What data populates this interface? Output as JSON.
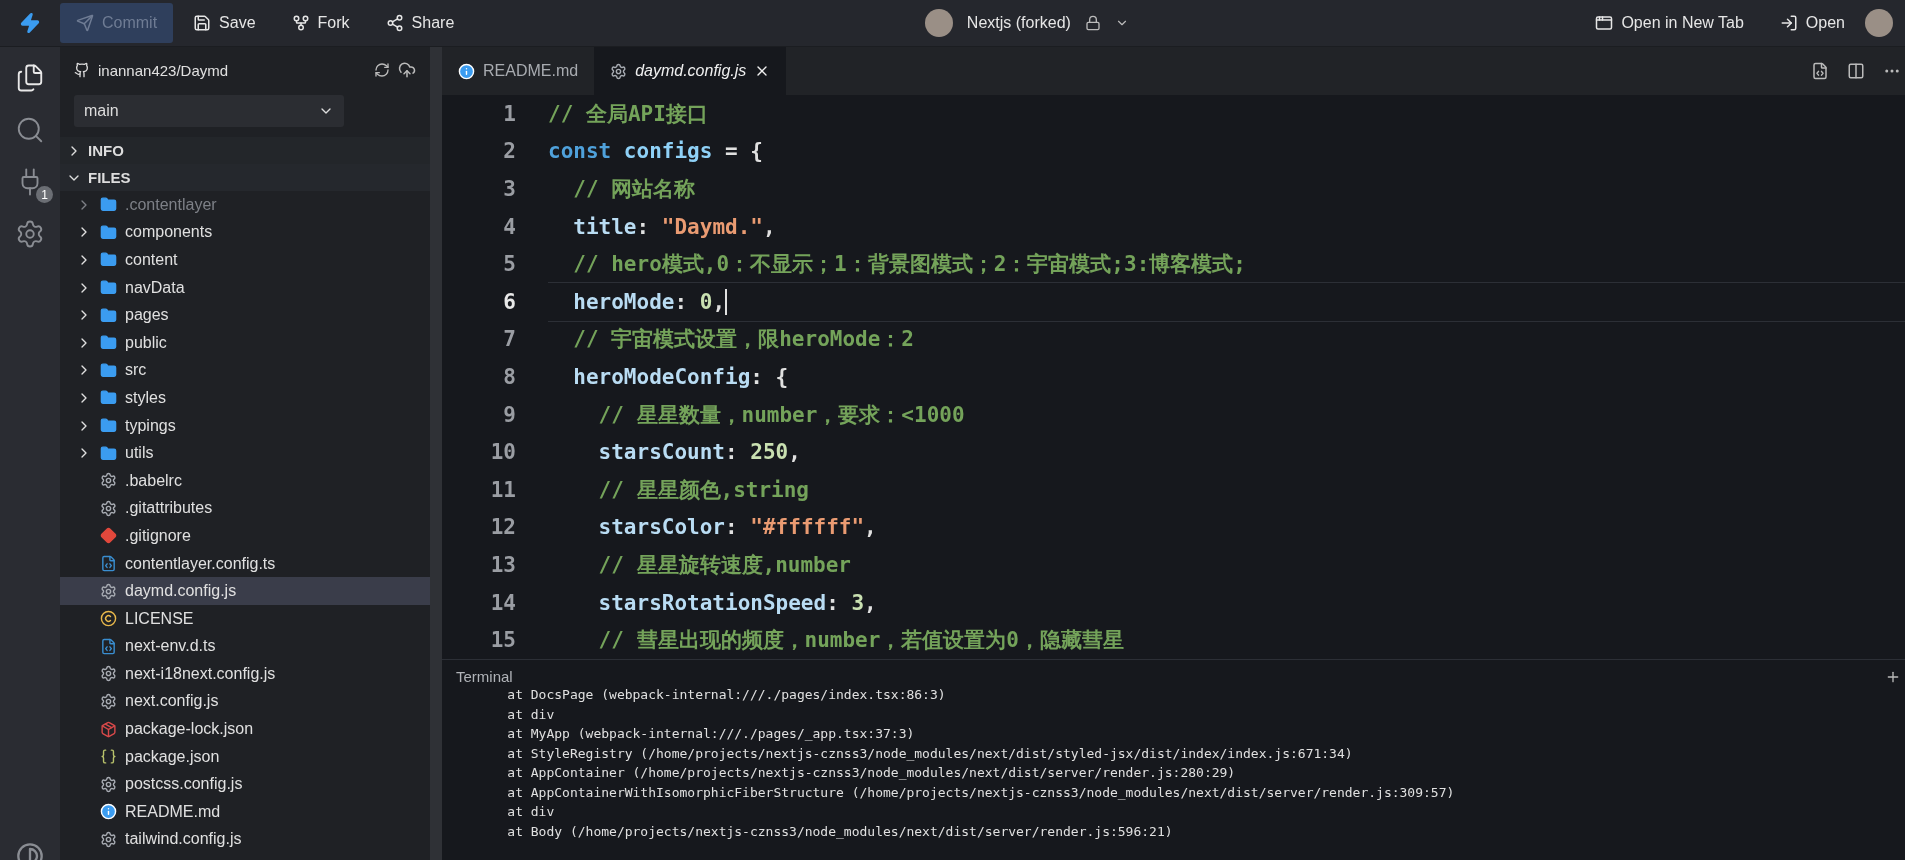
{
  "top_bar": {
    "actions": [
      {
        "kind": "commit",
        "label": "Commit",
        "disabled": true
      },
      {
        "kind": "save",
        "label": "Save",
        "disabled": false
      },
      {
        "kind": "fork",
        "label": "Fork",
        "disabled": false
      },
      {
        "kind": "share",
        "label": "Share",
        "disabled": false
      }
    ],
    "project_title": "Nextjs (forked)",
    "right_actions": [
      {
        "kind": "new-tab",
        "label": "Open in New Tab"
      },
      {
        "kind": "open",
        "label": "Open"
      }
    ]
  },
  "activity_bar": {
    "items": [
      {
        "kind": "files",
        "selected": true
      },
      {
        "kind": "search",
        "selected": false
      },
      {
        "kind": "plug",
        "selected": false,
        "badge": "1"
      },
      {
        "kind": "settings",
        "selected": false
      }
    ]
  },
  "sidebar": {
    "repo": "inannan423/Daymd",
    "branch": "main",
    "sections": [
      {
        "label": "INFO",
        "expanded": false
      },
      {
        "label": "FILES",
        "expanded": true
      }
    ],
    "files": [
      {
        "name": ".contentlayer",
        "kind": "folder",
        "ignored": true,
        "selected": false
      },
      {
        "name": "components",
        "kind": "folder",
        "ignored": false,
        "selected": false
      },
      {
        "name": "content",
        "kind": "folder",
        "ignored": false,
        "selected": false
      },
      {
        "name": "navData",
        "kind": "folder",
        "ignored": false,
        "selected": false
      },
      {
        "name": "pages",
        "kind": "folder",
        "ignored": false,
        "selected": false
      },
      {
        "name": "public",
        "kind": "folder",
        "ignored": false,
        "selected": false
      },
      {
        "name": "src",
        "kind": "folder",
        "ignored": false,
        "selected": false
      },
      {
        "name": "styles",
        "kind": "folder",
        "ignored": false,
        "selected": false
      },
      {
        "name": "typings",
        "kind": "folder",
        "ignored": false,
        "selected": false
      },
      {
        "name": "utils",
        "kind": "folder",
        "ignored": false,
        "selected": false
      },
      {
        "name": ".babelrc",
        "kind": "config",
        "ignored": false,
        "selected": false
      },
      {
        "name": ".gitattributes",
        "kind": "config",
        "ignored": false,
        "selected": false
      },
      {
        "name": ".gitignore",
        "kind": "git",
        "ignored": false,
        "selected": false
      },
      {
        "name": "contentlayer.config.ts",
        "kind": "ts",
        "ignored": false,
        "selected": false
      },
      {
        "name": "daymd.config.js",
        "kind": "config",
        "ignored": false,
        "selected": true
      },
      {
        "name": "LICENSE",
        "kind": "license",
        "ignored": false,
        "selected": false
      },
      {
        "name": "next-env.d.ts",
        "kind": "ts",
        "ignored": false,
        "selected": false
      },
      {
        "name": "next-i18next.config.js",
        "kind": "config",
        "ignored": false,
        "selected": false
      },
      {
        "name": "next.config.js",
        "kind": "config",
        "ignored": false,
        "selected": false
      },
      {
        "name": "package-lock.json",
        "kind": "npm",
        "ignored": false,
        "selected": false
      },
      {
        "name": "package.json",
        "kind": "json",
        "ignored": false,
        "selected": false
      },
      {
        "name": "postcss.config.js",
        "kind": "config",
        "ignored": false,
        "selected": false
      },
      {
        "name": "README.md",
        "kind": "info",
        "ignored": false,
        "selected": false
      },
      {
        "name": "tailwind.config.js",
        "kind": "config",
        "ignored": false,
        "selected": false
      }
    ]
  },
  "editor": {
    "tabs": [
      {
        "label": "README.md",
        "kind": "info",
        "selected": false
      },
      {
        "label": "daymd.config.js",
        "kind": "config",
        "selected": true
      }
    ],
    "lines": [
      {
        "number": "1",
        "current": false,
        "tokens": [
          {
            "kind": "comment",
            "s": "// 全局API接口"
          }
        ]
      },
      {
        "number": "2",
        "current": false,
        "tokens": [
          {
            "kind": "keyword",
            "s": "const "
          },
          {
            "kind": "name",
            "s": "configs"
          },
          {
            "kind": "punct",
            "s": " = {"
          }
        ]
      },
      {
        "number": "3",
        "current": false,
        "tokens": [
          {
            "kind": "comment",
            "s": "  // 网站名称"
          }
        ]
      },
      {
        "number": "4",
        "current": false,
        "tokens": [
          {
            "kind": "prop",
            "s": "  title"
          },
          {
            "kind": "punct",
            "s": ": "
          },
          {
            "kind": "string",
            "s": "\"Daymd.\""
          },
          {
            "kind": "punct",
            "s": ","
          }
        ]
      },
      {
        "number": "5",
        "current": false,
        "tokens": [
          {
            "kind": "comment",
            "s": "  // hero模式,0：不显示；1：背景图模式；2：宇宙模式;3:博客模式;"
          }
        ]
      },
      {
        "number": "6",
        "current": true,
        "tokens": [
          {
            "kind": "prop",
            "s": "  heroMode"
          },
          {
            "kind": "punct",
            "s": ": "
          },
          {
            "kind": "number",
            "s": "0"
          },
          {
            "kind": "punct",
            "s": ","
          }
        ]
      },
      {
        "number": "7",
        "current": false,
        "tokens": [
          {
            "kind": "comment",
            "s": "  // 宇宙模式设置，限heroMode：2"
          }
        ]
      },
      {
        "number": "8",
        "current": false,
        "tokens": [
          {
            "kind": "prop",
            "s": "  heroModeConfig"
          },
          {
            "kind": "punct",
            "s": ": {"
          }
        ]
      },
      {
        "number": "9",
        "current": false,
        "tokens": [
          {
            "kind": "comment",
            "s": "    // 星星数量，number，要求：<1000"
          }
        ]
      },
      {
        "number": "10",
        "current": false,
        "tokens": [
          {
            "kind": "prop",
            "s": "    starsCount"
          },
          {
            "kind": "punct",
            "s": ": "
          },
          {
            "kind": "number",
            "s": "250"
          },
          {
            "kind": "punct",
            "s": ","
          }
        ]
      },
      {
        "number": "11",
        "current": false,
        "tokens": [
          {
            "kind": "comment",
            "s": "    // 星星颜色,string"
          }
        ]
      },
      {
        "number": "12",
        "current": false,
        "tokens": [
          {
            "kind": "prop",
            "s": "    starsColor"
          },
          {
            "kind": "punct",
            "s": ": "
          },
          {
            "kind": "string",
            "s": "\"#ffffff\""
          },
          {
            "kind": "punct",
            "s": ","
          }
        ]
      },
      {
        "number": "13",
        "current": false,
        "tokens": [
          {
            "kind": "comment",
            "s": "    // 星星旋转速度,number"
          }
        ]
      },
      {
        "number": "14",
        "current": false,
        "tokens": [
          {
            "kind": "prop",
            "s": "    starsRotationSpeed"
          },
          {
            "kind": "punct",
            "s": ": "
          },
          {
            "kind": "number",
            "s": "3"
          },
          {
            "kind": "punct",
            "s": ","
          }
        ]
      },
      {
        "number": "15",
        "current": false,
        "tokens": [
          {
            "kind": "comment",
            "s": "    // 彗星出现的频度，number，若值设置为0，隐藏彗星"
          }
        ]
      }
    ]
  },
  "terminal": {
    "title": "Terminal",
    "lines": [
      "    at DocsPage (webpack-internal:///./pages/index.tsx:86:3)",
      "    at div",
      "    at MyApp (webpack-internal:///./pages/_app.tsx:37:3)",
      "    at StyleRegistry (/home/projects/nextjs-cznss3/node_modules/next/dist/styled-jsx/dist/index/index.js:671:34)",
      "    at AppContainer (/home/projects/nextjs-cznss3/node_modules/next/dist/server/render.js:280:29)",
      "    at AppContainerWithIsomorphicFiberStructure (/home/projects/nextjs-cznss3/node_modules/next/dist/server/render.js:309:57)",
      "    at div",
      "    at Body (/home/projects/nextjs-cznss3/node_modules/next/dist/server/render.js:596:21)"
    ]
  }
}
